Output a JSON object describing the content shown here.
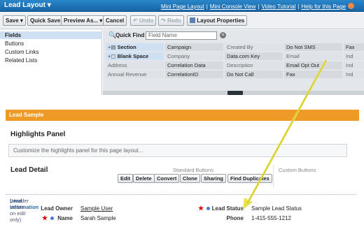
{
  "header": {
    "title": "Lead Layout",
    "links": [
      "Mini Page Layout",
      "Mini Console View",
      "Video Tutorial",
      "Help for this Page"
    ]
  },
  "toolbar": {
    "save": "Save",
    "quick_save": "Quick Save",
    "preview": "Preview As...",
    "cancel": "Cancel",
    "undo": "Undo",
    "redo": "Redo",
    "layout_properties": "Layout Properties"
  },
  "left_panel": {
    "items": [
      "Fields",
      "Buttons",
      "Custom Links",
      "Related Lists"
    ]
  },
  "palette": {
    "quick_find_label": "Quick Find",
    "quick_find_placeholder": "Field Name",
    "rows": [
      [
        "Section",
        "Campaign",
        "Created By",
        "Do Not SMS",
        "Fax"
      ],
      [
        "Blank Space",
        "Company",
        "Data.com Key",
        "Email",
        "Ind"
      ],
      [
        "Address",
        "Correlation Data",
        "Description",
        "Email Opt Out",
        "Ind"
      ],
      [
        "Annual Revenue",
        "CorrelationID",
        "Do Not Call",
        "Fax",
        "Ind"
      ]
    ]
  },
  "page": {
    "bar_title": "Lead Sample",
    "highlights_title": "Highlights Panel",
    "highlights_hint": "Customize the highlights panel for this page layout...",
    "detail_title": "Lead Detail",
    "standard_buttons_label": "Standard Buttons",
    "custom_buttons_label": "Custom Buttons",
    "detail_buttons": [
      "Edit",
      "Delete",
      "Convert",
      "Clone",
      "Sharing",
      "Find Duplicates"
    ],
    "section_title": "Lead Information",
    "section_note": "(Header visible on edit only)",
    "fields": {
      "lead_owner_label": "Lead Owner",
      "lead_owner_value": "Sample User",
      "name_label": "Name",
      "name_value": "Sarah Sample",
      "lead_status_label": "Lead Status",
      "lead_status_value": "Sample Lead Status",
      "phone_label": "Phone",
      "phone_value": "1-415-555-1212"
    }
  },
  "colors": {
    "header_blue": "#1a73b8",
    "orange_bar": "#ee9a27",
    "arrow_yellow": "#e8e24a"
  }
}
